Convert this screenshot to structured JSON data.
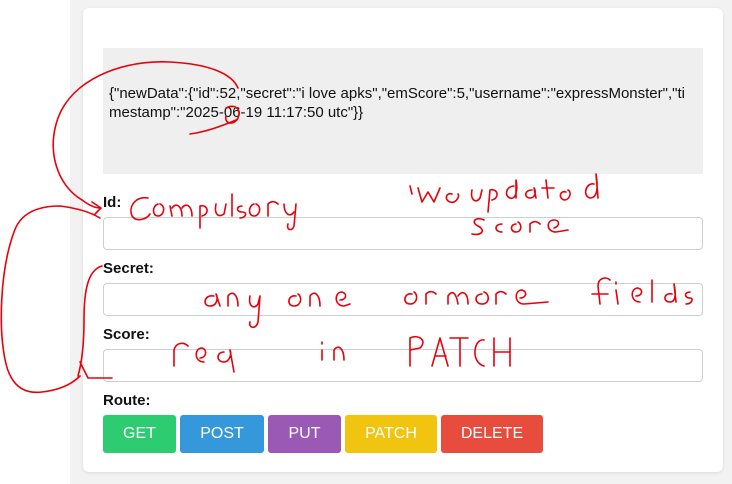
{
  "output": {
    "text": "{\"newData\":{\"id\":52,\"secret\":\"i love apks\",\"emScore\":5,\"username\":\"expressMonster\",\"timestamp\":\"2025-06-19 11:17:50 utc\"}}"
  },
  "form": {
    "id_label": "Id:",
    "id_value": "",
    "secret_label": "Secret:",
    "secret_value": "",
    "score_label": "Score:",
    "score_value": "",
    "route_label": "Route:"
  },
  "buttons": [
    {
      "label": "GET",
      "color": "#2ecc71"
    },
    {
      "label": "POST",
      "color": "#3498db"
    },
    {
      "label": "PUT",
      "color": "#9b59b6"
    },
    {
      "label": "PATCH",
      "color": "#f1c40f"
    },
    {
      "label": "DELETE",
      "color": "#e74c3c"
    }
  ],
  "annotations": {
    "compulsory": "Compulsory",
    "we_updated": "We updated",
    "score": "Score",
    "any_one": "any one or more fields",
    "req_in_patch": "req in PATCH",
    "ink_color": "#e8000a"
  }
}
